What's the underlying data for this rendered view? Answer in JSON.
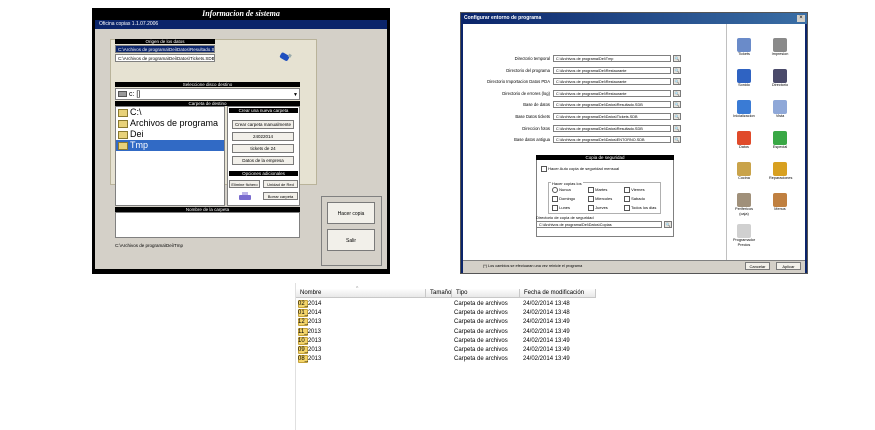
{
  "window1": {
    "title": "Informacion de sistema",
    "subtitle": "Oficina copias 1.1.07.2006",
    "origin_header": "Origen de los datos",
    "origin_paths": [
      "C:\\Archivos de programa\\Dei\\Datos\\Resultado.SDB",
      "C:\\Archivos de programa\\Dei\\Datos\\Tickets.SDB"
    ],
    "drive_header": "Seleccione disco destino",
    "drive_value": "c: []",
    "folder_header": "Carpeta de destino",
    "tree": [
      "C:\\",
      "Archivos de programa",
      "Dei",
      "Tmp"
    ],
    "create_header": "Crear una nueva carpeta",
    "btn_create_manual": "Crear carpeta manualmente",
    "btn_date": "24022014",
    "btn_tickets": "tickets de 24",
    "btn_company": "Datos de la empresa",
    "options_header": "Opciones adicionales",
    "btn_delete": "Elimine fichero",
    "btn_network": "Unidad de Red",
    "btn_delete_folder": "Borrar carpeta",
    "name_header": "Nombre de la carpeta",
    "btn_make_copy": "Hacer copia",
    "btn_exit": "Salir",
    "status_path": "C:\\Archivos de programa\\Dei\\Tmp"
  },
  "window2": {
    "title": "Configurar entorno de programa",
    "rows": [
      {
        "label": "Directorio temporal",
        "value": "C:\\Archivos de programa\\Dei\\Tmp"
      },
      {
        "label": "Directorio del programa",
        "value": "C:\\Archivos de programa\\Dei\\Restaurante"
      },
      {
        "label": "Directorio Importacion Datos PDA",
        "value": "C:\\Archivos de programa\\Dei\\Restaurante"
      },
      {
        "label": "Directorio de errores (log)",
        "value": "C:\\Archivos de programa\\Dei\\Restaurante"
      },
      {
        "label": "Base de datos",
        "value": "C:\\Archivos de programa\\Dei\\Datos\\Resultado.SDB"
      },
      {
        "label": "Base Datos tickets",
        "value": "C:\\Archivos de programa\\Dei\\Datos\\Tickets.SDB"
      },
      {
        "label": "Direccion fotos",
        "value": "C:\\Archivos de programa\\Dei\\Datos\\Resultado.SDB"
      },
      {
        "label": "Base datos antigua",
        "value": "C:\\Archivos de programa\\Dei\\Datos\\ENTORNO.SDB"
      }
    ],
    "backup_header": "Copia de seguridad",
    "backup_check": "Hacer Auto copia de seguridad mensual",
    "make_copy_label": "Hacer copias los",
    "days": [
      "Nunca",
      "Martes",
      "Viernes",
      "Domingo",
      "Miercoles",
      "Sabado",
      "Lunes",
      "Jueves",
      "Todos los dias"
    ],
    "backup_dir_label": "Directorio de copia de seguridad",
    "backup_dir_value": "C:\\Archivos de programa\\Dei\\Datos\\Copias",
    "sidebar": [
      "Tickets",
      "Impresion",
      "Sonido",
      "Directorio",
      "Inicializacion",
      "Vista",
      "Datos",
      "Especial",
      "Cocina",
      "Reparaciones",
      "Perifericos (caja)",
      "Menus",
      "Programador Precios"
    ],
    "footer_note": "(*) Los cambios se efectuaran una vez reinicie el programa",
    "btn_cancel": "Cancelar",
    "btn_apply": "Aplicar"
  },
  "explorer": {
    "headers": {
      "name": "Nombre",
      "size": "Tamaño",
      "type": "Tipo",
      "date": "Fecha de modificación"
    },
    "rows": [
      {
        "name": "02_2014",
        "type": "Carpeta de archivos",
        "date": "24/02/2014 13:48"
      },
      {
        "name": "01_2014",
        "type": "Carpeta de archivos",
        "date": "24/02/2014 13:48"
      },
      {
        "name": "12_2013",
        "type": "Carpeta de archivos",
        "date": "24/02/2014 13:49"
      },
      {
        "name": "11_2013",
        "type": "Carpeta de archivos",
        "date": "24/02/2014 13:49"
      },
      {
        "name": "10_2013",
        "type": "Carpeta de archivos",
        "date": "24/02/2014 13:49"
      },
      {
        "name": "09_2013",
        "type": "Carpeta de archivos",
        "date": "24/02/2014 13:49"
      },
      {
        "name": "08_2013",
        "type": "Carpeta de archivos",
        "date": "24/02/2014 13:49"
      }
    ]
  }
}
